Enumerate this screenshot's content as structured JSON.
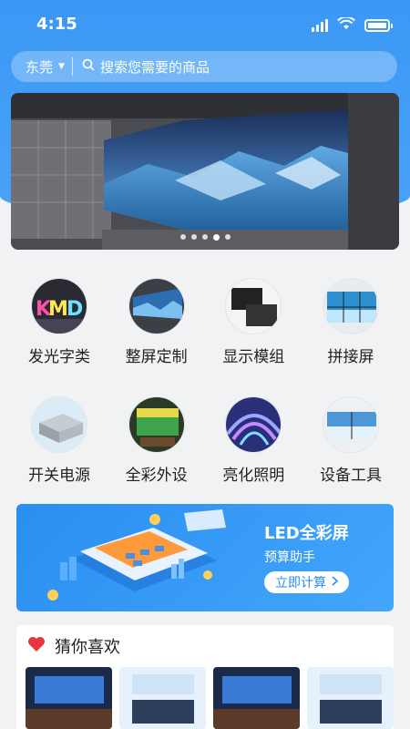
{
  "status": {
    "time": "4:15"
  },
  "search": {
    "city": "东莞",
    "placeholder": "搜索您需要的商品"
  },
  "banner": {
    "slide_count": 5,
    "active_index": 3
  },
  "categories": [
    {
      "label": "发光字类",
      "icon": "luminous-letters-icon"
    },
    {
      "label": "整屏定制",
      "icon": "custom-screen-icon"
    },
    {
      "label": "显示模组",
      "icon": "display-module-icon"
    },
    {
      "label": "拼接屏",
      "icon": "splicing-screen-icon"
    },
    {
      "label": "开关电源",
      "icon": "power-supply-icon"
    },
    {
      "label": "全彩外设",
      "icon": "full-color-peripheral-icon"
    },
    {
      "label": "亮化照明",
      "icon": "lighting-icon"
    },
    {
      "label": "设备工具",
      "icon": "equipment-tools-icon"
    }
  ],
  "promo": {
    "title": "LED全彩屏",
    "subtitle": "预算助手",
    "cta": "立即计算"
  },
  "guess": {
    "title": "猜你喜欢"
  },
  "colors": {
    "accent": "#3a98f5",
    "heart": "#e8383d"
  }
}
